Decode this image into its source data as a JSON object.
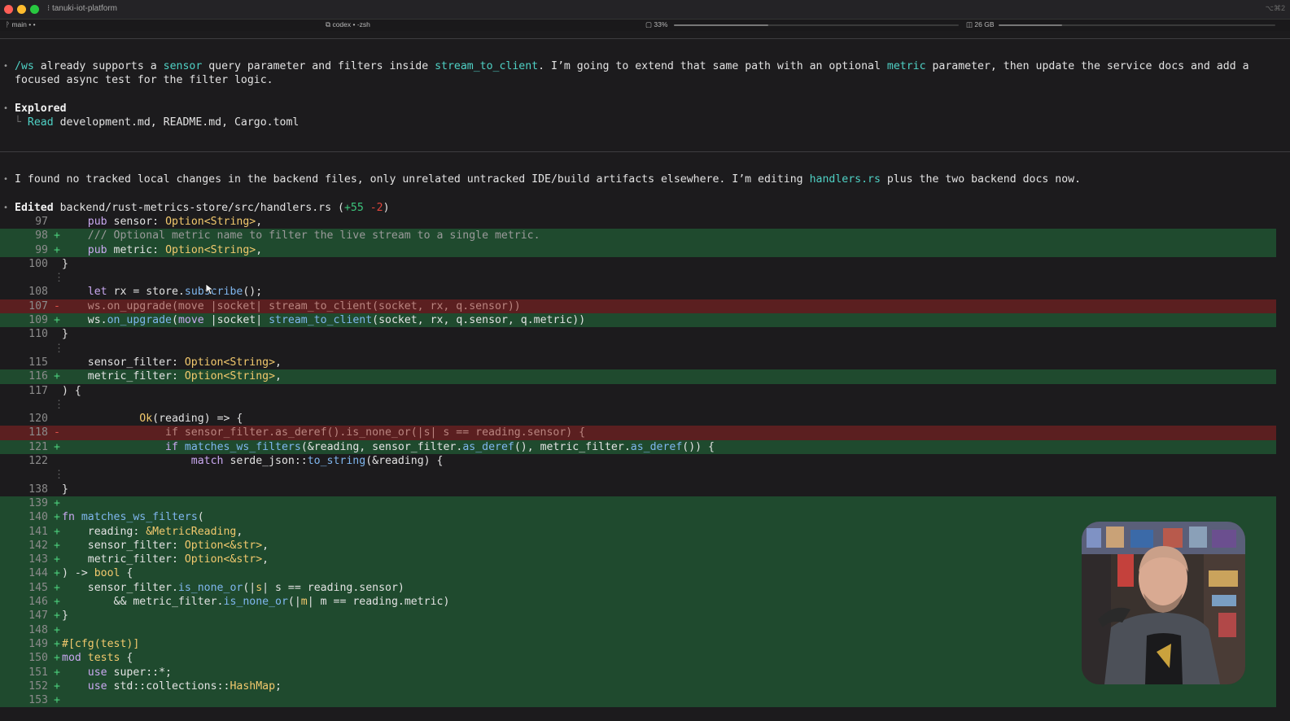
{
  "window": {
    "title": "tanuki-iot-platform",
    "corner": "⌥⌘2"
  },
  "status": {
    "branch": "main • •",
    "tab": "codex • -zsh",
    "cpu": "33%",
    "cpu_fraction": 0.33,
    "mem": "26 GB",
    "mem_fraction": 0.23
  },
  "msg1": {
    "p1": "/ws",
    "p2": " already supports a ",
    "p3": "sensor",
    "p4": " query parameter and filters inside ",
    "p5": "stream_to_client",
    "p6": ". I’m going to extend that same path with an optional ",
    "p7": "metric",
    "p8": " parameter, then update the service docs and add a",
    "line2": "focused async test for the filter logic."
  },
  "explored": {
    "title": "Explored",
    "verb": "Read",
    "files": "development.md, README.md, Cargo.toml"
  },
  "msg2": {
    "p1": "I found no tracked local changes in the backend files, only unrelated untracked IDE/build artifacts elsewhere. I’m editing ",
    "p2": "handlers.rs",
    "p3": " plus the two backend docs now."
  },
  "edited": {
    "label": "Edited",
    "path": "backend/rust-metrics-store/src/handlers.rs",
    "added": "+55",
    "removed": "-2"
  },
  "diff": {
    "l97": "97",
    "l98": "98",
    "l99": "99",
    "l100": "100",
    "l108": "108",
    "l107": "107",
    "l109": "109",
    "l110": "110",
    "l115": "115",
    "l116": "116",
    "l117": "117",
    "l120": "120",
    "l118": "118",
    "l121": "121",
    "l122": "122",
    "l138": "138",
    "l139": "139",
    "l140": "140",
    "l141": "141",
    "l142": "142",
    "l143": "143",
    "l144": "144",
    "l145": "145",
    "l146": "146",
    "l147": "147",
    "l148": "148",
    "l149": "149",
    "l150": "150",
    "l151": "151",
    "l152": "152",
    "l153": "153"
  },
  "webcam": {
    "label": "presenter-webcam"
  }
}
